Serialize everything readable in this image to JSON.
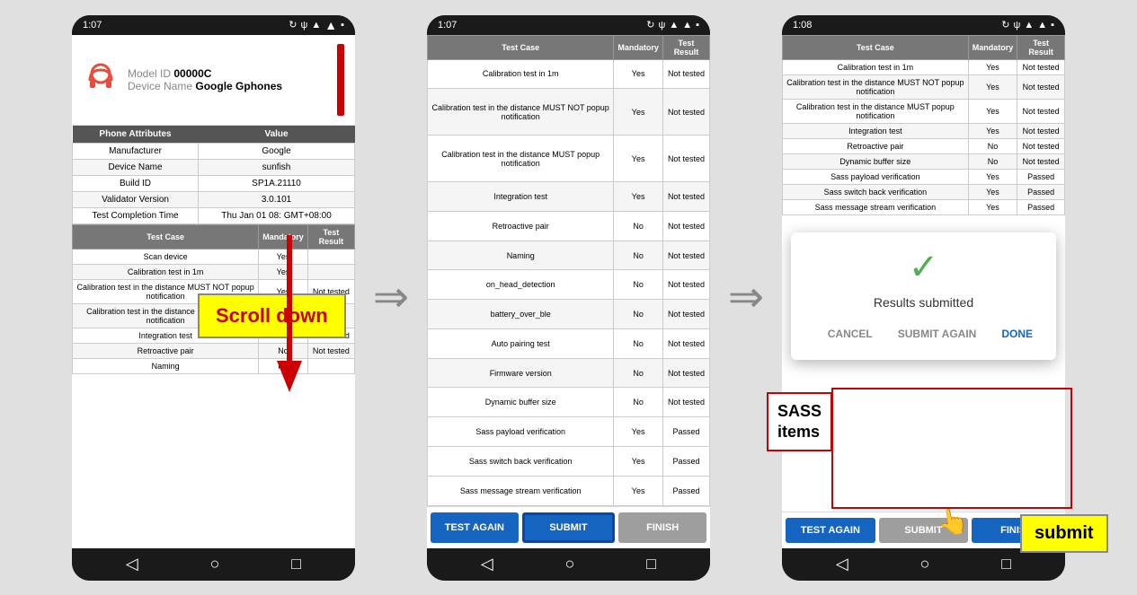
{
  "phones": [
    {
      "id": "phone1",
      "status_bar": {
        "time": "1:07",
        "icons": "↻ ψ ▲ ★ ▼ ▪"
      },
      "device": {
        "model_label": "Model ID",
        "model_value": "00000C",
        "device_label": "Device Name",
        "device_value": "Google Gphones"
      },
      "attr_headers": [
        "Phone Attributes",
        "Value"
      ],
      "attr_rows": [
        [
          "Manufacturer",
          "Google"
        ],
        [
          "Device Name",
          "sunfish"
        ],
        [
          "Build ID",
          "SP1A.21110"
        ],
        [
          "Validator Version",
          "3.0.101"
        ],
        [
          "Test Completion Time",
          "Thu Jan 01 08: GMT+08:00"
        ]
      ],
      "test_headers": [
        "Test Case",
        "Mandatory",
        "Test Result"
      ],
      "test_rows": [
        [
          "Scan device",
          "Yes",
          ""
        ],
        [
          "Calibration test in 1m",
          "Yes",
          ""
        ],
        [
          "Calibration test in the distance MUST NOT popup notification",
          "Yes",
          "Not tested"
        ],
        [
          "Calibration test in the distance MUST popup notification",
          "Yes",
          "Not"
        ],
        [
          "Integration test",
          "Yes",
          "Not tested"
        ],
        [
          "Retroactive pair",
          "No",
          "Not tested"
        ],
        [
          "Naming",
          "No",
          ""
        ]
      ]
    },
    {
      "id": "phone2",
      "status_bar": {
        "time": "1:07",
        "icons": "↻ ψ ▲ ★ ▼ ▪"
      },
      "test_rows": [
        [
          "Calibration test in 1m",
          "Yes",
          "Not tested"
        ],
        [
          "Calibration test in the distance MUST NOT popup notification",
          "Yes",
          "Not tested"
        ],
        [
          "Calibration test in the distance MUST popup notification",
          "Yes",
          "Not tested"
        ],
        [
          "Integration test",
          "Yes",
          "Not tested"
        ],
        [
          "Retroactive pair",
          "No",
          "Not tested"
        ],
        [
          "Naming",
          "No",
          "Not tested"
        ],
        [
          "on_head_detection",
          "No",
          "Not tested"
        ],
        [
          "battery_over_ble",
          "No",
          "Not tested"
        ],
        [
          "Auto pairing test",
          "No",
          "Not tested"
        ],
        [
          "Firmware version",
          "No",
          "Not tested"
        ],
        [
          "Dynamic buffer size",
          "No",
          "Not tested"
        ],
        [
          "Sass payload verification",
          "Yes",
          "Passed"
        ],
        [
          "Sass switch back verification",
          "Yes",
          "Passed"
        ],
        [
          "Sass message stream verification",
          "Yes",
          "Passed"
        ]
      ],
      "buttons": {
        "test_again": "TEST AGAIN",
        "submit": "SUBMIT",
        "finish": "FINISH"
      }
    },
    {
      "id": "phone3",
      "status_bar": {
        "time": "1:08",
        "icons": "↻ ψ ▲ ★ ▼ ▪"
      },
      "test_rows": [
        [
          "Calibration test in 1m",
          "Yes",
          "Not tested"
        ],
        [
          "Calibration test in the distance MUST NOT popup notification",
          "Yes",
          "Not tested"
        ],
        [
          "Calibration test in the distance MUST popup notification",
          "Yes",
          "Not tested"
        ],
        [
          "Integration test",
          "Yes",
          "Not tested"
        ],
        [
          "Retroactive pair",
          "No",
          "Not tested"
        ],
        [
          "Dynamic buffer size",
          "No",
          "Not tested"
        ],
        [
          "Sass payload verification",
          "Yes",
          "Passed"
        ],
        [
          "Sass switch back verification",
          "Yes",
          "Passed"
        ],
        [
          "Sass message stream verification",
          "Yes",
          "Passed"
        ]
      ],
      "dialog": {
        "icon": "✓",
        "message": "Results submitted",
        "cancel_label": "CANCEL",
        "submit_again_label": "SUBMIT AGAIN",
        "done_label": "DONE"
      },
      "buttons": {
        "test_again": "TEST AGAIN",
        "submit": "SUBMIT",
        "finish": "FINISH"
      }
    }
  ],
  "annotations": {
    "scroll_down": "Scroll down",
    "sass_items": "SASS\nitems",
    "submit_label": "submit"
  },
  "arrows": {
    "arrow1": "⇒",
    "arrow2": "⇒"
  }
}
